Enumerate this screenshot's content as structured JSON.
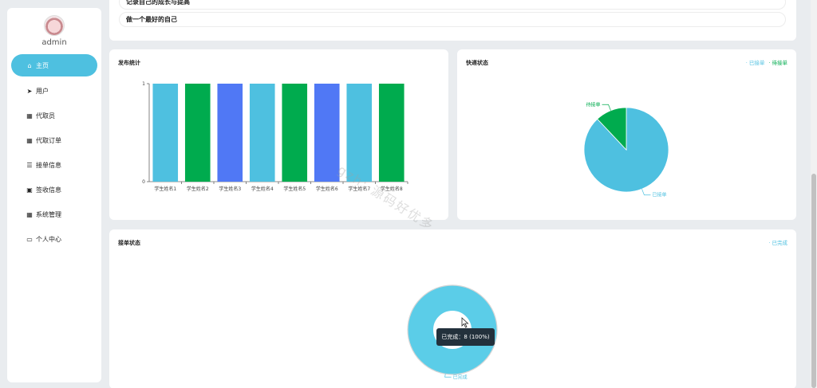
{
  "sidebar": {
    "user": "admin",
    "items": [
      {
        "label": "主页",
        "icon": "home-icon",
        "glyph": "⌂"
      },
      {
        "label": "用户",
        "icon": "send-icon",
        "glyph": "➤"
      },
      {
        "label": "代取员",
        "icon": "grid-icon",
        "glyph": "▦"
      },
      {
        "label": "代取订单",
        "icon": "grid-icon",
        "glyph": "▦"
      },
      {
        "label": "接单信息",
        "icon": "list-icon",
        "glyph": "☰"
      },
      {
        "label": "签收信息",
        "icon": "clipboard-icon",
        "glyph": "▣"
      },
      {
        "label": "系统管理",
        "icon": "grid-icon",
        "glyph": "▦"
      },
      {
        "label": "个人中心",
        "icon": "window-icon",
        "glyph": "▭"
      }
    ]
  },
  "top": {
    "motto_partial": "记录自己的成长与提高",
    "motto": "做一个最好的自己"
  },
  "release_card": {
    "title": "发布统计"
  },
  "express_card": {
    "title": "快递状态",
    "legend": [
      "已接单",
      "待接单"
    ]
  },
  "order_card": {
    "title": "接单状态",
    "legend": [
      "已完成"
    ],
    "tooltip": "已完成：8 (100%)"
  },
  "watermark": "gzh: 源码好优多",
  "colors": {
    "accent": "#4ec0e0",
    "green": "#00ab4e",
    "blue": "#5078f5",
    "tooltip_bg": "#23313c"
  },
  "chart_data": [
    {
      "type": "bar",
      "title": "发布统计",
      "categories": [
        "学生姓名1",
        "学生姓名2",
        "学生姓名3",
        "学生姓名4",
        "学生姓名5",
        "学生姓名6",
        "学生姓名7",
        "学生姓名8"
      ],
      "values": [
        1,
        1,
        1,
        1,
        1,
        1,
        1,
        1
      ],
      "bar_colors": [
        "#4ec0e0",
        "#00ab4e",
        "#5078f5",
        "#4ec0e0",
        "#00ab4e",
        "#5078f5",
        "#4ec0e0",
        "#00ab4e"
      ],
      "yticks": [
        0,
        1
      ],
      "ylim": [
        0,
        1
      ]
    },
    {
      "type": "pie",
      "title": "快递状态",
      "slices": [
        {
          "label": "已接单",
          "value": 0.88,
          "color": "#4ec0e0"
        },
        {
          "label": "待接单",
          "value": 0.12,
          "color": "#00ab4e"
        }
      ]
    },
    {
      "type": "pie",
      "title": "接单状态",
      "donut": true,
      "slices": [
        {
          "label": "已完成",
          "value": 8,
          "color": "#5bcde8"
        }
      ]
    }
  ]
}
